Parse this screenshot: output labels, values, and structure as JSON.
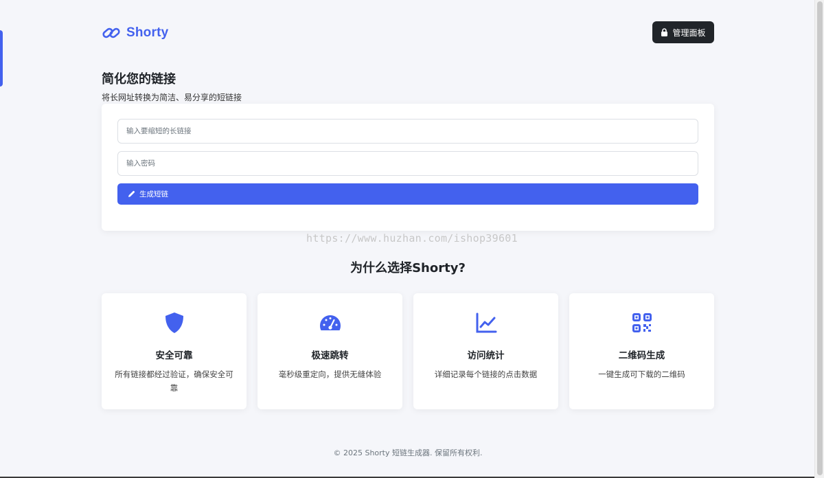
{
  "brand": {
    "name": "Shorty",
    "accent": "#4361ee"
  },
  "header": {
    "admin_label": "管理面板"
  },
  "hero": {
    "title": "简化您的链接",
    "subtitle": "将长网址转换为简洁、易分享的短链接"
  },
  "form": {
    "url_placeholder": "输入要缩短的长链接",
    "password_placeholder": "输入密码",
    "submit_label": "生成短链"
  },
  "watermark": "https://www.huzhan.com/ishop39601",
  "why": {
    "title": "为什么选择Shorty?",
    "features": [
      {
        "icon": "shield-icon",
        "title": "安全可靠",
        "desc": "所有链接都经过验证，确保安全可靠"
      },
      {
        "icon": "speedometer-icon",
        "title": "极速跳转",
        "desc": "毫秒级重定向，提供无缝体验"
      },
      {
        "icon": "chart-line-icon",
        "title": "访问统计",
        "desc": "详细记录每个链接的点击数据"
      },
      {
        "icon": "qrcode-icon",
        "title": "二维码生成",
        "desc": "一键生成可下载的二维码"
      }
    ]
  },
  "footer": {
    "text": "© 2025 Shorty 短链生成器. 保留所有权利."
  }
}
